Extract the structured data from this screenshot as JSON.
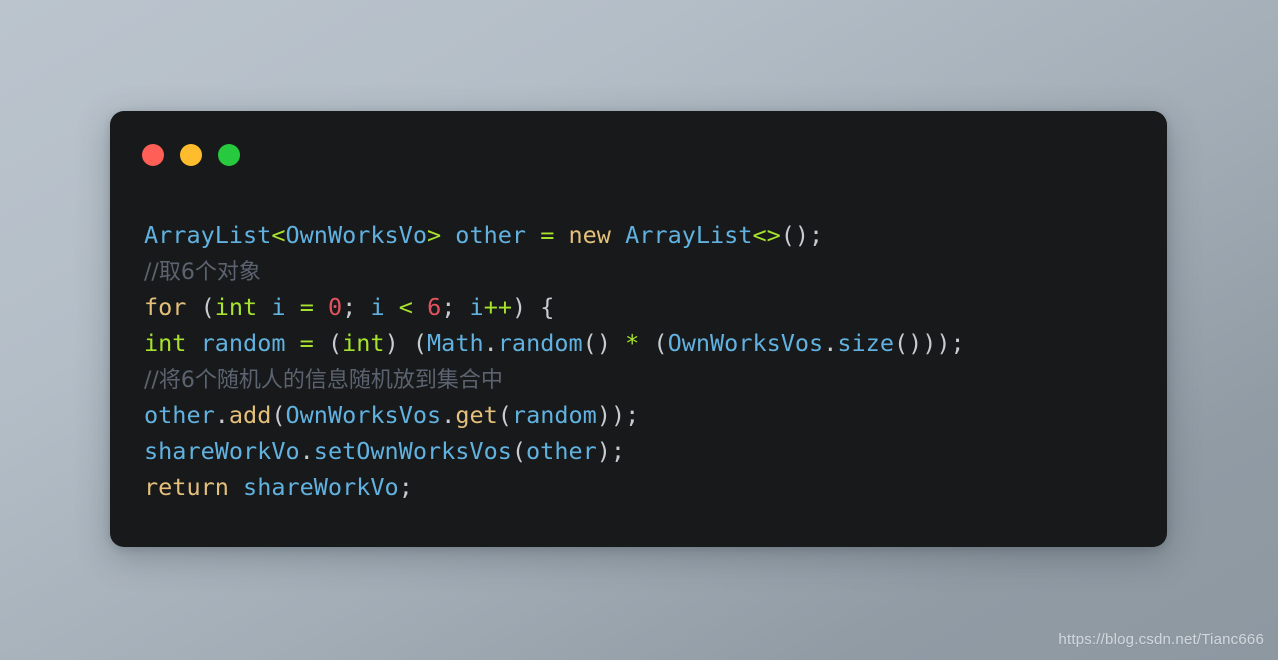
{
  "window": {
    "controls": [
      {
        "name": "close",
        "color": "#ff5f56",
        "label": ""
      },
      {
        "name": "minimize",
        "color": "#ffbd2e",
        "label": ""
      },
      {
        "name": "maximize",
        "color": "#27c93f",
        "label": ""
      }
    ],
    "background_color": "#17191a"
  },
  "page": {
    "background_gradient_from": "#bbc4cd",
    "background_gradient_to": "#8e98a1"
  },
  "code": {
    "language": "java",
    "lines": [
      {
        "n": 1,
        "text": "ArrayList<OwnWorksVo> other = new ArrayList<>();",
        "tokens": [
          {
            "t": "ArrayList",
            "c": "type"
          },
          {
            "t": "<",
            "c": "op"
          },
          {
            "t": "OwnWorksVo",
            "c": "type"
          },
          {
            "t": ">",
            "c": "op"
          },
          {
            "t": " ",
            "c": "plain"
          },
          {
            "t": "other",
            "c": "var"
          },
          {
            "t": " ",
            "c": "plain"
          },
          {
            "t": "=",
            "c": "op"
          },
          {
            "t": " ",
            "c": "plain"
          },
          {
            "t": "new",
            "c": "kw"
          },
          {
            "t": " ",
            "c": "plain"
          },
          {
            "t": "ArrayList",
            "c": "type"
          },
          {
            "t": "<>",
            "c": "op"
          },
          {
            "t": "();",
            "c": "punct"
          }
        ]
      },
      {
        "n": 2,
        "text": "//取6个对象",
        "tokens": [
          {
            "t": "//取6个对象",
            "c": "comment-cn"
          }
        ]
      },
      {
        "n": 3,
        "text": "for (int i = 0; i < 6; i++) {",
        "tokens": [
          {
            "t": "for",
            "c": "kw"
          },
          {
            "t": " ",
            "c": "plain"
          },
          {
            "t": "(",
            "c": "punct"
          },
          {
            "t": "int",
            "c": "kw2"
          },
          {
            "t": " ",
            "c": "plain"
          },
          {
            "t": "i",
            "c": "var"
          },
          {
            "t": " ",
            "c": "plain"
          },
          {
            "t": "=",
            "c": "op"
          },
          {
            "t": " ",
            "c": "plain"
          },
          {
            "t": "0",
            "c": "num"
          },
          {
            "t": "; ",
            "c": "punct"
          },
          {
            "t": "i",
            "c": "var"
          },
          {
            "t": " ",
            "c": "plain"
          },
          {
            "t": "<",
            "c": "op"
          },
          {
            "t": " ",
            "c": "plain"
          },
          {
            "t": "6",
            "c": "num"
          },
          {
            "t": "; ",
            "c": "punct"
          },
          {
            "t": "i",
            "c": "var"
          },
          {
            "t": "++",
            "c": "op"
          },
          {
            "t": ") {",
            "c": "punct"
          }
        ]
      },
      {
        "n": 4,
        "text": "int random = (int) (Math.random() * (OwnWorksVos.size()));",
        "tokens": [
          {
            "t": "int",
            "c": "kw2"
          },
          {
            "t": " ",
            "c": "plain"
          },
          {
            "t": "random",
            "c": "var"
          },
          {
            "t": " ",
            "c": "plain"
          },
          {
            "t": "=",
            "c": "op"
          },
          {
            "t": " ",
            "c": "plain"
          },
          {
            "t": "(",
            "c": "punct"
          },
          {
            "t": "int",
            "c": "kw2"
          },
          {
            "t": ") (",
            "c": "punct"
          },
          {
            "t": "Math",
            "c": "type"
          },
          {
            "t": ".",
            "c": "punct"
          },
          {
            "t": "random",
            "c": "var"
          },
          {
            "t": "() ",
            "c": "punct"
          },
          {
            "t": "*",
            "c": "op"
          },
          {
            "t": " (",
            "c": "punct"
          },
          {
            "t": "OwnWorksVos",
            "c": "type"
          },
          {
            "t": ".",
            "c": "punct"
          },
          {
            "t": "size",
            "c": "var"
          },
          {
            "t": "()));",
            "c": "punct"
          }
        ]
      },
      {
        "n": 5,
        "text": "//将6个随机人的信息随机放到集合中",
        "tokens": [
          {
            "t": "//将6个随机人的信息随机放到集合中",
            "c": "comment-cn"
          }
        ]
      },
      {
        "n": 6,
        "text": "other.add(OwnWorksVos.get(random));",
        "tokens": [
          {
            "t": "other",
            "c": "var"
          },
          {
            "t": ".",
            "c": "punct"
          },
          {
            "t": "add",
            "c": "fn"
          },
          {
            "t": "(",
            "c": "punct"
          },
          {
            "t": "OwnWorksVos",
            "c": "type"
          },
          {
            "t": ".",
            "c": "punct"
          },
          {
            "t": "get",
            "c": "fn"
          },
          {
            "t": "(",
            "c": "punct"
          },
          {
            "t": "random",
            "c": "var"
          },
          {
            "t": "));",
            "c": "punct"
          }
        ]
      },
      {
        "n": 7,
        "text": "shareWorkVo.setOwnWorksVos(other);",
        "tokens": [
          {
            "t": "shareWorkVo",
            "c": "var"
          },
          {
            "t": ".",
            "c": "punct"
          },
          {
            "t": "setOwnWorksVos",
            "c": "var"
          },
          {
            "t": "(",
            "c": "punct"
          },
          {
            "t": "other",
            "c": "var"
          },
          {
            "t": ");",
            "c": "punct"
          }
        ]
      },
      {
        "n": 8,
        "text": "return shareWorkVo;",
        "tokens": [
          {
            "t": "return",
            "c": "kw"
          },
          {
            "t": " ",
            "c": "plain"
          },
          {
            "t": "shareWorkVo",
            "c": "var"
          },
          {
            "t": ";",
            "c": "punct"
          }
        ]
      }
    ]
  },
  "watermark": {
    "text": "https://blog.csdn.net/Tianc666"
  }
}
